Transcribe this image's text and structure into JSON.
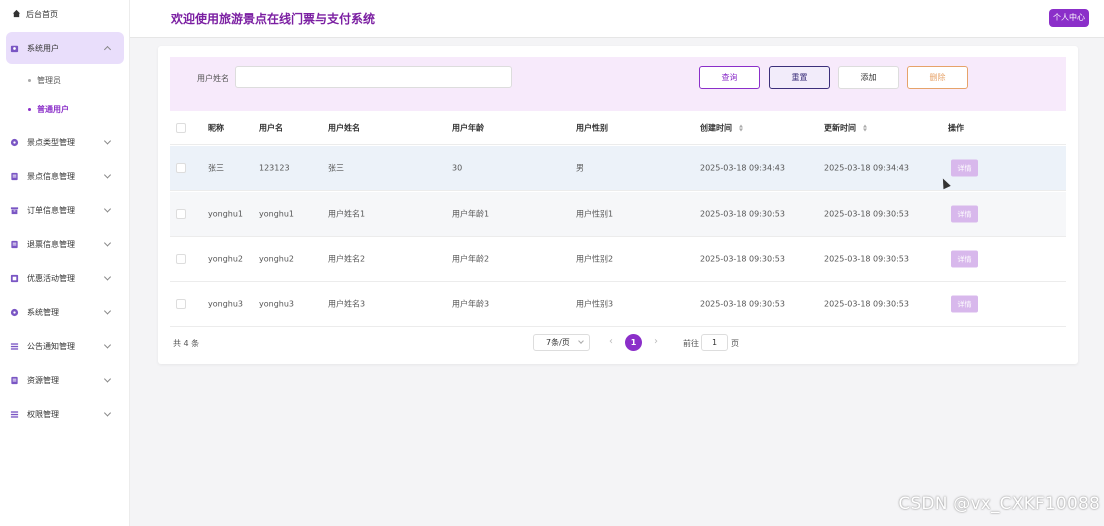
{
  "sidebar": {
    "home": {
      "label": "后台首页",
      "icon": "home-icon"
    },
    "menus": [
      {
        "label": "系统用户",
        "icon": "user-icon",
        "expanded": true,
        "children": [
          {
            "label": "管理员",
            "active": false
          },
          {
            "label": "普通用户",
            "active": true
          }
        ]
      },
      {
        "label": "景点类型管理",
        "icon": "tag-icon"
      },
      {
        "label": "景点信息管理",
        "icon": "document-icon"
      },
      {
        "label": "订单信息管理",
        "icon": "box-icon"
      },
      {
        "label": "退票信息管理",
        "icon": "document-icon"
      },
      {
        "label": "优惠活动管理",
        "icon": "gift-icon"
      },
      {
        "label": "系统管理",
        "icon": "tag-icon"
      },
      {
        "label": "公告通知管理",
        "icon": "list-icon"
      },
      {
        "label": "资源管理",
        "icon": "document-icon"
      },
      {
        "label": "权限管理",
        "icon": "list-icon"
      }
    ]
  },
  "header": {
    "title": "欢迎使用旅游景点在线门票与支付系统",
    "profile_button": "个人中心"
  },
  "search": {
    "label": "用户姓名",
    "placeholder": "",
    "buttons": {
      "query": "查询",
      "reset": "重置",
      "add": "添加",
      "delete": "删除"
    }
  },
  "table": {
    "columns": [
      "昵称",
      "用户名",
      "用户姓名",
      "用户年龄",
      "用户性别",
      "创建时间",
      "更新时间",
      "操作"
    ],
    "rows": [
      {
        "nickname": "张三",
        "username": "123123",
        "name": "张三",
        "age": "30",
        "gender": "男",
        "created": "2025-03-18 09:34:43",
        "updated": "2025-03-18 09:34:43",
        "action": "详情"
      },
      {
        "nickname": "yonghu1",
        "username": "yonghu1",
        "name": "用户姓名1",
        "age": "用户年龄1",
        "gender": "用户性别1",
        "created": "2025-03-18 09:30:53",
        "updated": "2025-03-18 09:30:53",
        "action": "详情"
      },
      {
        "nickname": "yonghu2",
        "username": "yonghu2",
        "name": "用户姓名2",
        "age": "用户年龄2",
        "gender": "用户性别2",
        "created": "2025-03-18 09:30:53",
        "updated": "2025-03-18 09:30:53",
        "action": "详情"
      },
      {
        "nickname": "yonghu3",
        "username": "yonghu3",
        "name": "用户姓名3",
        "age": "用户年龄3",
        "gender": "用户性别3",
        "created": "2025-03-18 09:30:53",
        "updated": "2025-03-18 09:30:53",
        "action": "详情"
      }
    ]
  },
  "pagination": {
    "total": "共 4 条",
    "page_size": "7条/页",
    "current_page": "1",
    "goto_prefix": "前往",
    "goto_value": "1",
    "goto_suffix": "页"
  },
  "watermark": "CSDN @vx_CXKF10088",
  "colors": {
    "accent": "#8b2fc9",
    "title": "#7b1fa2",
    "search_bg": "#f7eafb",
    "detail_button": "#d8b8ec"
  }
}
